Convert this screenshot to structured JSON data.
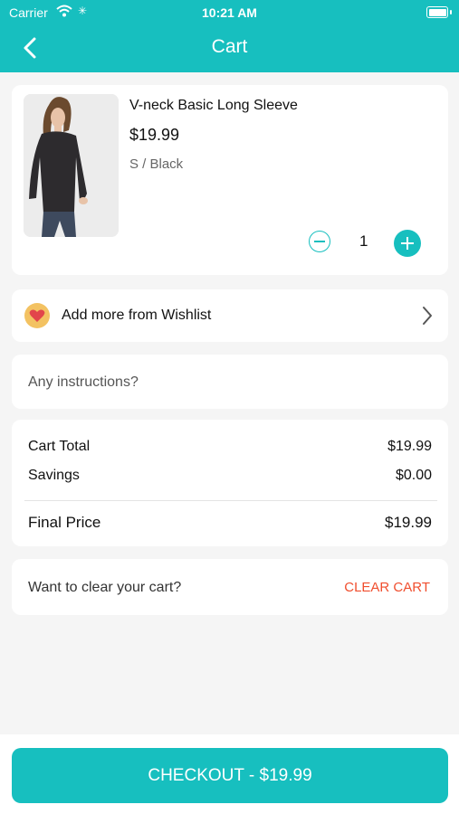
{
  "status_bar": {
    "carrier": "Carrier",
    "time": "10:21 AM"
  },
  "nav": {
    "title": "Cart"
  },
  "product": {
    "name": "V-neck Basic Long Sleeve",
    "price": "$19.99",
    "variant": "S / Black",
    "quantity": "1"
  },
  "wishlist": {
    "label": "Add more from Wishlist"
  },
  "instructions": {
    "placeholder": "Any instructions?"
  },
  "summary": {
    "cart_total_label": "Cart Total",
    "cart_total_value": "$19.99",
    "savings_label": "Savings",
    "savings_value": "$0.00",
    "final_label": "Final Price",
    "final_value": "$19.99"
  },
  "clear_cart": {
    "question": "Want to clear your cart?",
    "button": "CLEAR CART"
  },
  "checkout": {
    "label": "CHECKOUT - $19.99"
  },
  "colors": {
    "accent": "#17bfbf",
    "danger": "#f04e2e"
  }
}
